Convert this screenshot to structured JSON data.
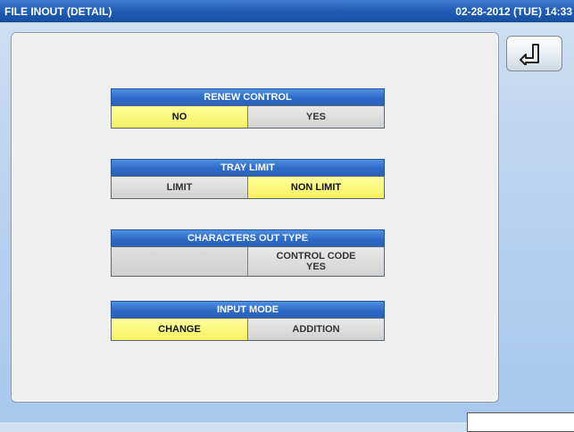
{
  "header": {
    "title": "FILE INOUT (DETAIL)",
    "datetime": "02-28-2012 (TUE) 14:33"
  },
  "back_button": {
    "icon": "back-arrow-icon"
  },
  "groups": {
    "renew_control": {
      "title": "RENEW CONTROL",
      "options": [
        "NO",
        "YES"
      ],
      "selected": "NO"
    },
    "tray_limit": {
      "title": "TRAY LIMIT",
      "options": [
        "LIMIT",
        "NON LIMIT"
      ],
      "selected": "NON LIMIT"
    },
    "characters_out_type": {
      "title": "CHARACTERS OUT TYPE",
      "options": [
        {
          "line1": "CONTROL CODE",
          "line2": "NO"
        },
        {
          "line1": "CONTROL CODE",
          "line2": "YES"
        }
      ]
    },
    "input_mode": {
      "title": "INPUT MODE",
      "options": [
        "CHANGE",
        "ADDITION"
      ],
      "selected": "CHANGE"
    }
  },
  "colors": {
    "selected": "#f7f060",
    "header": "#2d6ac8",
    "title_bar": "#1e5cb6"
  }
}
